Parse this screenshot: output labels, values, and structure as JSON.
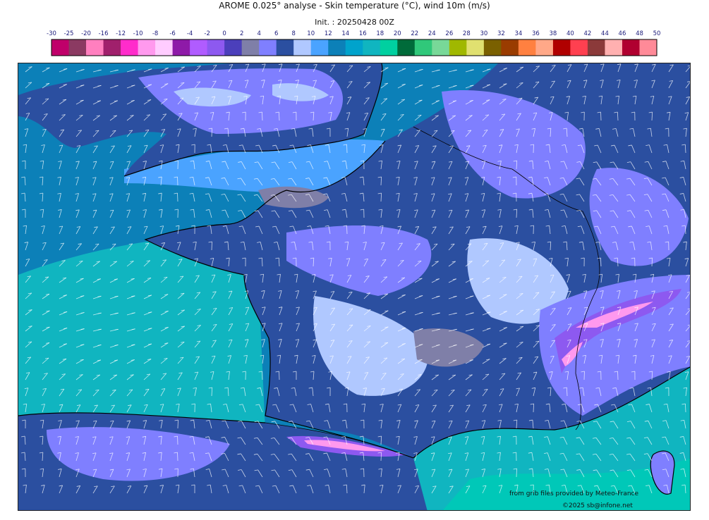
{
  "header": {
    "title": "AROME 0.025° analyse - Skin temperature (°C), wind 10m (m/s)",
    "init": "Init. : 20250428 00Z"
  },
  "colorbar": {
    "ticks": [
      "-30",
      "-25",
      "-20",
      "-16",
      "-12",
      "-10",
      "-8",
      "-6",
      "-4",
      "-2",
      "0",
      "2",
      "4",
      "6",
      "8",
      "10",
      "12",
      "14",
      "16",
      "18",
      "20",
      "22",
      "24",
      "26",
      "28",
      "30",
      "32",
      "34",
      "36",
      "38",
      "40",
      "42",
      "44",
      "46",
      "48",
      "50"
    ],
    "colors": [
      "#c0006a",
      "#8b3a62",
      "#ff7fbf",
      "#a0206c",
      "#ff2ccb",
      "#ff99ee",
      "#ffccff",
      "#8e1aa8",
      "#b05cff",
      "#8d59f0",
      "#4b3fbb",
      "#7f7fa8",
      "#7f7fff",
      "#2b4fa0",
      "#b0c8ff",
      "#4aa3ff",
      "#0c80b8",
      "#00a3cc",
      "#10b5c0",
      "#00d0a0",
      "#006b3a",
      "#30c87a",
      "#78d898",
      "#a0b800",
      "#e0e070",
      "#7a6000",
      "#9a3c00",
      "#ff8040",
      "#ffa888",
      "#b00000",
      "#ff4050",
      "#8b3a3a",
      "#ffb0b0",
      "#b00030",
      "#ff8a98"
    ]
  },
  "map": {
    "land_colors": [
      "#2b4fa0",
      "#7f7fff",
      "#b0c8ff",
      "#7f7fa8",
      "#4aa3ff"
    ],
    "sea_colors": [
      "#4aa3ff",
      "#0c80b8",
      "#00a3cc",
      "#10b5c0"
    ],
    "mountain_colors": [
      "#8d59f0",
      "#b05cff",
      "#ff99ee"
    ],
    "coastline_color": "#000000",
    "wind_barb_color": "#ffffff"
  },
  "credits": {
    "source": "from grib files provided by Meteo-France",
    "copyright": "©2025 sb@infone.net"
  }
}
